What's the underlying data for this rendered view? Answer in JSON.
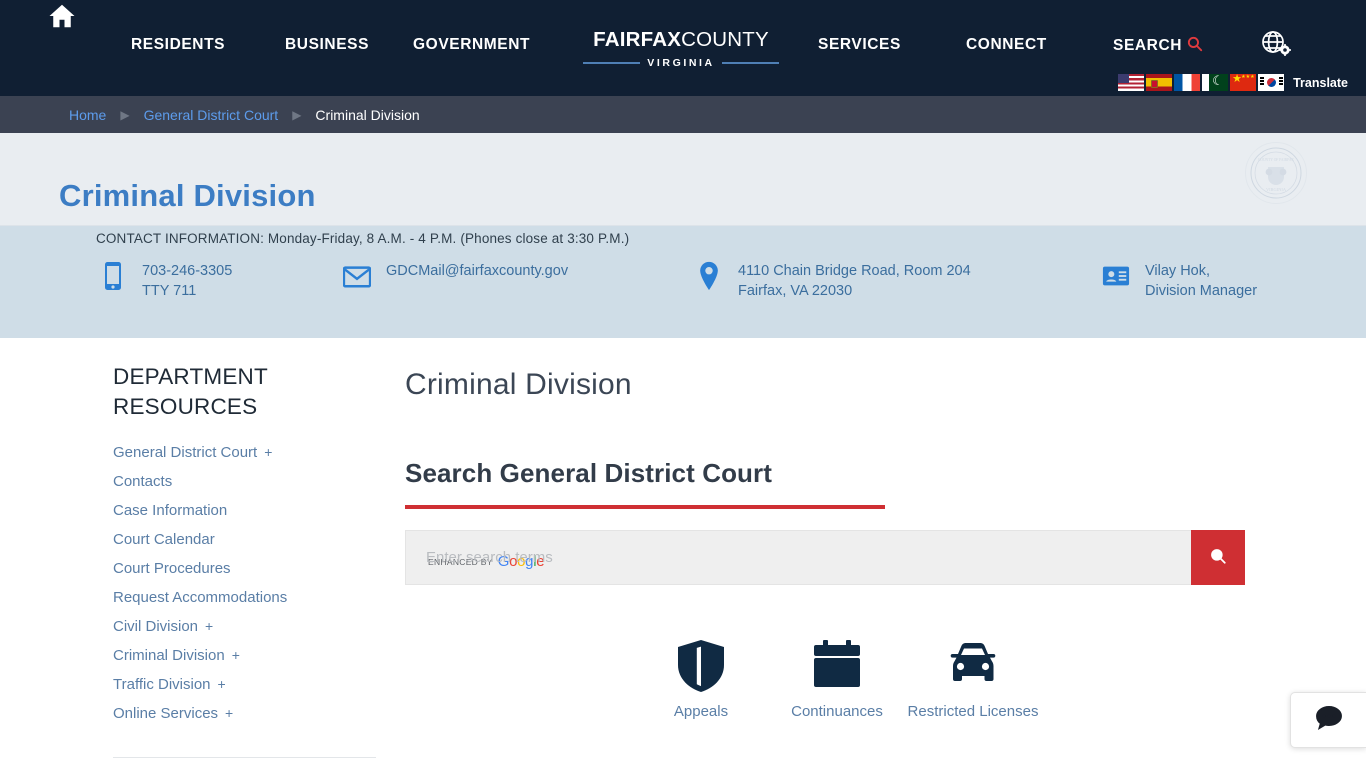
{
  "header": {
    "home_icon": "home-icon",
    "nav": [
      {
        "label": "RESIDENTS"
      },
      {
        "label": "BUSINESS"
      },
      {
        "label": "GOVERNMENT"
      },
      {
        "label": "SERVICES"
      },
      {
        "label": "CONNECT"
      }
    ],
    "brand": {
      "bold": "FAIRFAX",
      "light": "COUNTY",
      "sub": "VIRGINIA"
    },
    "search": {
      "label": "SEARCH",
      "icon": "search-icon"
    },
    "globe": {
      "icon": "globe-settings-icon"
    },
    "translate": {
      "label": "Translate",
      "flags": [
        {
          "name": "flag-us",
          "title": "English"
        },
        {
          "name": "flag-es",
          "title": "Espanol"
        },
        {
          "name": "flag-fr",
          "title": "Francais"
        },
        {
          "name": "flag-pk",
          "title": "Urdu"
        },
        {
          "name": "flag-cn",
          "title": "Chinese"
        },
        {
          "name": "flag-kr",
          "title": "Korean"
        }
      ]
    },
    "colors": {
      "bar": "#101f33",
      "accent_red": "#cf2f33"
    }
  },
  "breadcrumb": {
    "items": [
      {
        "label": "Home",
        "current": false
      },
      {
        "label": "General District Court",
        "current": false
      },
      {
        "label": "Criminal Division",
        "current": true
      }
    ],
    "separator": "▶"
  },
  "title_band": {
    "title": "Criminal Division",
    "seal": "county-seal-watermark"
  },
  "contact": {
    "heading": "CONTACT INFORMATION: Monday-Friday, 8 A.M. - 4 P.M. (Phones close at 3:30 P.M.)",
    "phone": {
      "icon": "mobile-phone-icon",
      "line1": "703-246-3305",
      "line2": "TTY 711"
    },
    "email": {
      "icon": "envelope-icon",
      "line1": "GDCMail@fairfaxcounty.gov"
    },
    "address": {
      "icon": "map-pin-icon",
      "line1": "4110 Chain Bridge Road, Room 204",
      "line2": "Fairfax, VA 22030"
    },
    "person": {
      "icon": "id-card-icon",
      "line1": "Vilay Hok,",
      "line2": "Division Manager"
    }
  },
  "sidebar": {
    "title": "DEPARTMENT RESOURCES",
    "items": [
      {
        "label": "General District Court",
        "expandable": true,
        "plus": "+"
      },
      {
        "label": "Contacts",
        "expandable": false,
        "plus": ""
      },
      {
        "label": "Case Information",
        "expandable": false,
        "plus": ""
      },
      {
        "label": "Court Calendar",
        "expandable": false,
        "plus": ""
      },
      {
        "label": "Court Procedures",
        "expandable": false,
        "plus": ""
      },
      {
        "label": "Request Accommodations",
        "expandable": false,
        "plus": ""
      },
      {
        "label": "Civil Division",
        "expandable": true,
        "plus": "+"
      },
      {
        "label": "Criminal Division",
        "expandable": true,
        "plus": "+"
      },
      {
        "label": "Traffic Division",
        "expandable": true,
        "plus": "+"
      },
      {
        "label": "Online Services",
        "expandable": true,
        "plus": "+"
      }
    ]
  },
  "main": {
    "heading": "Criminal Division",
    "search_section_title": "Search General District Court",
    "search": {
      "placeholder": "Enter search terms",
      "value": "",
      "badge_prefix": "ENHANCED BY",
      "badge_brand": "Google",
      "submit_icon": "search-icon"
    },
    "tiles": [
      {
        "icon": "shield-icon",
        "label": "Appeals"
      },
      {
        "icon": "calendar-icon",
        "label": "Continuances"
      },
      {
        "icon": "car-icon",
        "label": "Restricted Licenses"
      }
    ]
  },
  "chat": {
    "icon": "chat-bubble-icon",
    "label": "Chat"
  }
}
